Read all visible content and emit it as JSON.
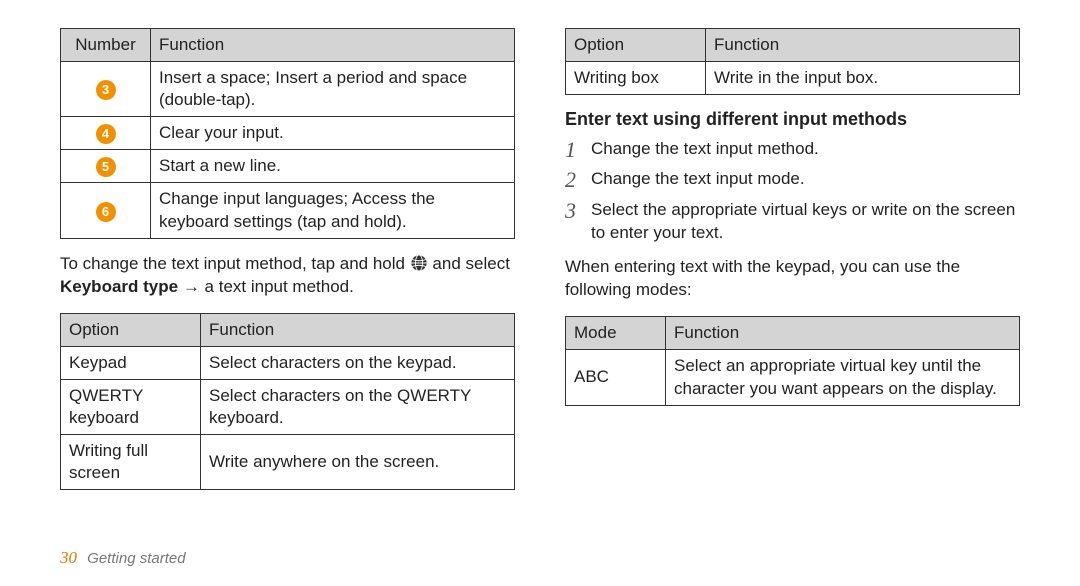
{
  "left": {
    "numberTable": {
      "headers": [
        "Number",
        "Function"
      ],
      "rows": [
        {
          "num": "3",
          "func": "Insert a space; Insert a period and space (double-tap)."
        },
        {
          "num": "4",
          "func": "Clear your input."
        },
        {
          "num": "5",
          "func": "Start a new line."
        },
        {
          "num": "6",
          "func": "Change input languages; Access the keyboard settings (tap and hold)."
        }
      ]
    },
    "para_before": "To change the text input method, tap and hold ",
    "para_after": " and select ",
    "para_bold": "Keyboard type",
    "para_tail": " → a text input method.",
    "optionTable": {
      "headers": [
        "Option",
        "Function"
      ],
      "rows": [
        {
          "opt": "Keypad",
          "func": "Select characters on the keypad."
        },
        {
          "opt": "QWERTY keyboard",
          "func": "Select characters on the QWERTY keyboard."
        },
        {
          "opt": "Writing full screen",
          "func": "Write anywhere on the screen."
        }
      ]
    }
  },
  "right": {
    "optionTable": {
      "headers": [
        "Option",
        "Function"
      ],
      "rows": [
        {
          "opt": "Writing box",
          "func": "Write in the input box."
        }
      ]
    },
    "heading": "Enter text using different input methods",
    "steps": [
      "Change the text input method.",
      "Change the text input mode.",
      "Select the appropriate virtual keys or write on the screen to enter your text."
    ],
    "para": "When entering text with the keypad, you can use the following modes:",
    "modeTable": {
      "headers": [
        "Mode",
        "Function"
      ],
      "rows": [
        {
          "mode": "ABC",
          "func": "Select an appropriate virtual key until the character you want appears on the display."
        }
      ]
    }
  },
  "footer": {
    "page": "30",
    "section": "Getting started"
  }
}
